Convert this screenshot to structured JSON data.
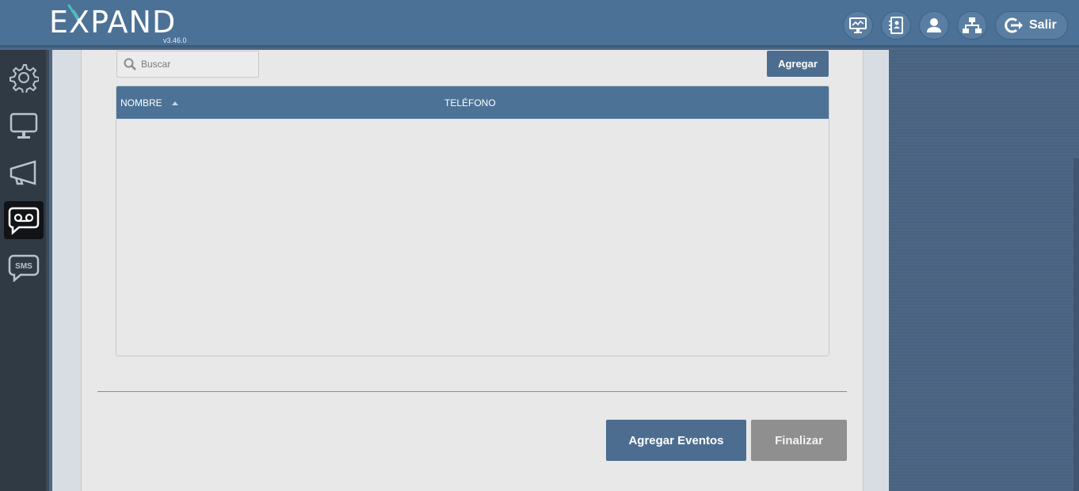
{
  "header": {
    "logo_text": "EXPAND",
    "version": "v3.46.0",
    "icons": [
      "dashboard-monitor-icon",
      "contacts-book-icon",
      "user-icon",
      "network-icon"
    ],
    "logout_label": "Salir"
  },
  "sidebar": {
    "items": [
      {
        "icon": "gear-icon"
      },
      {
        "icon": "monitor-icon"
      },
      {
        "icon": "megaphone-icon"
      },
      {
        "icon": "voicemail-icon",
        "active": true
      },
      {
        "icon": "sms-icon",
        "label": "SMS"
      }
    ]
  },
  "toolbar": {
    "search_placeholder": "Buscar",
    "add_label": "Agregar"
  },
  "table": {
    "columns": [
      "NOMBRE",
      "TELÉFONO"
    ],
    "rows": []
  },
  "footer": {
    "add_events_label": "Agregar Eventos",
    "finish_label": "Finalizar"
  },
  "colors": {
    "header_bg": "#4c7196",
    "primary_button": "#4c6d90",
    "disabled_button": "#8f8f8f",
    "table_header": "#4c7296",
    "accent": "#3fc0b8"
  }
}
